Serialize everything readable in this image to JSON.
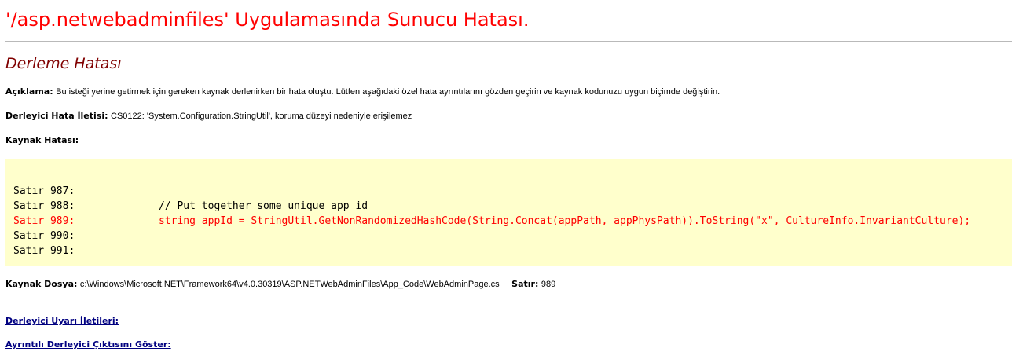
{
  "page": {
    "title": "'/asp.netwebadminfiles' Uygulamasında Sunucu Hatası.",
    "subtitle": "Derleme Hatası"
  },
  "description": {
    "label": "Açıklama:",
    "text": "Bu isteği yerine getirmek için gereken kaynak derlenirken bir hata oluştu. Lütfen aşağıdaki özel hata ayrıntılarını gözden geçirin ve kaynak kodunuzu uygun biçimde değiştirin."
  },
  "compiler_message": {
    "label": "Derleyici Hata İletisi:",
    "text": "CS0122: 'System.Configuration.StringUtil', koruma düzeyi nedeniyle erişilemez"
  },
  "source_error": {
    "label": "Kaynak Hatası:",
    "lines": [
      {
        "number": "Satır 987:",
        "code": ""
      },
      {
        "number": "Satır 988:",
        "code": "// Put together some unique app id"
      },
      {
        "number": "Satır 989:",
        "code": "string appId = StringUtil.GetNonRandomizedHashCode(String.Concat(appPath, appPhysPath)).ToString(\"x\", CultureInfo.InvariantCulture);"
      },
      {
        "number": "Satır 990:",
        "code": ""
      },
      {
        "number": "Satır 991:",
        "code": ""
      }
    ],
    "error_line_color": "#ff0000",
    "background_color": "#ffffcc"
  },
  "source_file": {
    "label": "Kaynak Dosya:",
    "path": "c:\\Windows\\Microsoft.NET\\Framework64\\v4.0.30319\\ASP.NETWebAdminFiles\\App_Code\\WebAdminPage.cs",
    "line_label": "Satır:",
    "line_value": "989"
  },
  "links": {
    "warnings": "Derleyici Uyarı İletileri:",
    "verbose_output": "Ayrıntılı Derleyici Çıktısını Göster:"
  },
  "colors": {
    "title": "#ff0000",
    "subtitle": "#800000",
    "link": "#000080"
  }
}
